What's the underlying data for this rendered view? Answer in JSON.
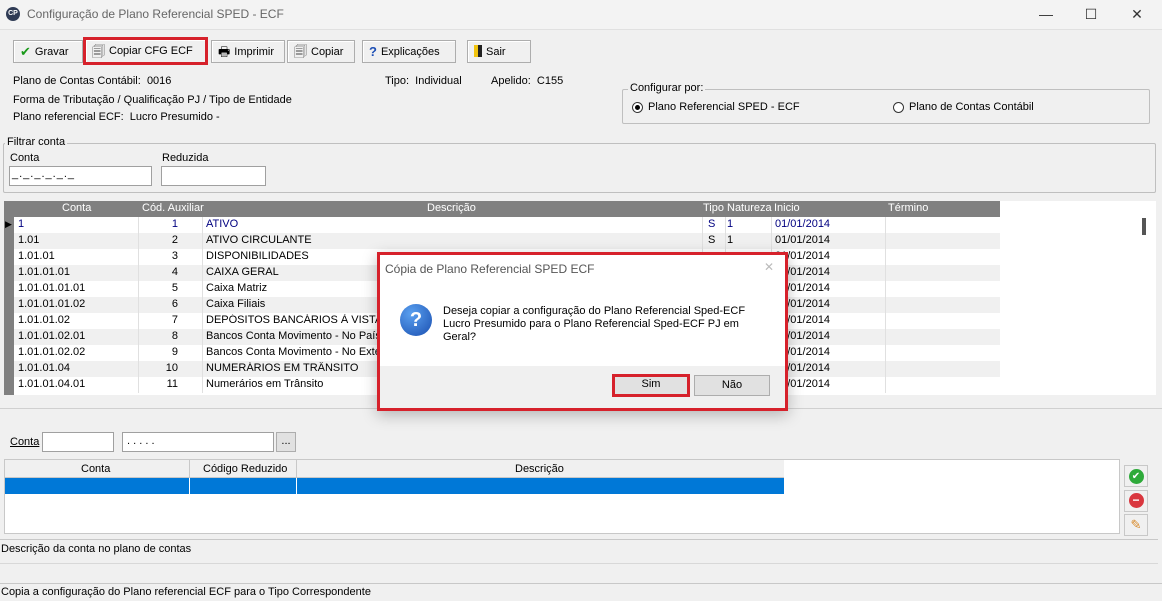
{
  "window": {
    "app_icon_text": "CP",
    "title": "Configuração de Plano Referencial SPED - ECF",
    "controls": [
      "—",
      "☐",
      "✕"
    ]
  },
  "toolbar": {
    "gravar": "Gravar",
    "copiar_cfg": "Copiar CFG ECF",
    "imprimir": "Imprimir",
    "copiar": "Copiar",
    "explicacoes": "Explicações",
    "sair": "Sair"
  },
  "info": {
    "plano_label": "Plano de Contas Contábil:",
    "plano_value": "0016",
    "tipo_label": "Tipo:",
    "tipo_value": "Individual",
    "apelido_label": "Apelido:",
    "apelido_value": "C155",
    "forma_tributacao": "Forma de Tributação / Qualificação PJ / Tipo de Entidade",
    "plano_ref_label": "Plano referencial ECF:",
    "plano_ref_value": "Lucro Presumido -"
  },
  "configurar": {
    "legend": "Configurar por:",
    "option1": "Plano Referencial SPED - ECF",
    "option2": "Plano de Contas Contábil",
    "selected": "option1"
  },
  "filtro": {
    "legend": "Filtrar conta",
    "conta_label": "Conta",
    "conta_mask": "_._._._._._",
    "reduzida_label": "Reduzida",
    "reduzida_value": ""
  },
  "grid": {
    "headers": [
      "Conta",
      "Cód. Auxiliar",
      "Descrição",
      "Tipo",
      "Natureza",
      "Inicio",
      "Término"
    ],
    "rows": [
      {
        "conta": "1",
        "cod": "1",
        "desc": "ATIVO",
        "tipo": "S",
        "natureza": "1",
        "inicio": "01/01/2014",
        "termino": ""
      },
      {
        "conta": "1.01",
        "cod": "2",
        "desc": "ATIVO CIRCULANTE",
        "tipo": "S",
        "natureza": "1",
        "inicio": "01/01/2014",
        "termino": ""
      },
      {
        "conta": "1.01.01",
        "cod": "3",
        "desc": "DISPONIBILIDADES",
        "tipo": "",
        "natureza": "",
        "inicio": "01/01/2014",
        "termino": ""
      },
      {
        "conta": "1.01.01.01",
        "cod": "4",
        "desc": "CAIXA GERAL",
        "tipo": "",
        "natureza": "",
        "inicio": "01/01/2014",
        "termino": ""
      },
      {
        "conta": "1.01.01.01.01",
        "cod": "5",
        "desc": "Caixa Matriz",
        "tipo": "",
        "natureza": "",
        "inicio": "01/01/2014",
        "termino": ""
      },
      {
        "conta": "1.01.01.01.02",
        "cod": "6",
        "desc": "Caixa Filiais",
        "tipo": "",
        "natureza": "",
        "inicio": "01/01/2014",
        "termino": ""
      },
      {
        "conta": "1.01.01.02",
        "cod": "7",
        "desc": "DEPÓSITOS BANCÁRIOS À VISTA",
        "tipo": "",
        "natureza": "",
        "inicio": "01/01/2014",
        "termino": ""
      },
      {
        "conta": "1.01.01.02.01",
        "cod": "8",
        "desc": "Bancos Conta Movimento - No País",
        "tipo": "",
        "natureza": "",
        "inicio": "01/01/2014",
        "termino": ""
      },
      {
        "conta": "1.01.01.02.02",
        "cod": "9",
        "desc": "Bancos Conta Movimento - No Exterior",
        "tipo": "",
        "natureza": "",
        "inicio": "01/01/2014",
        "termino": ""
      },
      {
        "conta": "1.01.01.04",
        "cod": "10",
        "desc": "NUMERÁRIOS EM TRÂNSITO",
        "tipo": "",
        "natureza": "",
        "inicio": "01/01/2014",
        "termino": ""
      },
      {
        "conta": "1.01.01.04.01",
        "cod": "11",
        "desc": "Numerários em Trânsito",
        "tipo": "",
        "natureza": "",
        "inicio": "01/01/2014",
        "termino": ""
      }
    ]
  },
  "dialog": {
    "title": "Cópia de Plano Referencial SPED ECF",
    "close": "✕",
    "message_line1": "Deseja copiar a configuração do Plano Referencial Sped-ECF",
    "message_line2": "Lucro Presumido para o Plano Referencial Sped-ECF PJ em",
    "message_line3": "Geral?",
    "yes": "Sim",
    "no": "Não"
  },
  "lower": {
    "conta_label": "Conta",
    "conta_value": "",
    "conta_mask": ". . . .  .",
    "browse": "...",
    "headers": [
      "Conta",
      "Código Reduzido",
      "Descrição"
    ]
  },
  "status": {
    "descricao": "Descrição da conta no plano de contas",
    "hint": "Copia a configuração do Plano referencial ECF para o Tipo Correspondente"
  },
  "colors": {
    "accent_selection": "#0078d7",
    "grid_header": "#808080",
    "highlight_red": "#d6212b",
    "link_blue": "#000080"
  }
}
